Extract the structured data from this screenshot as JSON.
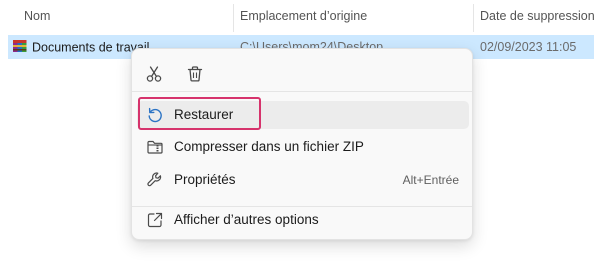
{
  "columns": {
    "name": "Nom",
    "origin": "Emplacement d’origine",
    "date": "Date de suppression"
  },
  "file": {
    "name": "Documents de travail",
    "origin": "C:\\Users\\mom24\\Desktop",
    "date": "02/09/2023 11:05",
    "icon": "winrar-archive-icon"
  },
  "context_menu": {
    "quick_actions": [
      {
        "name": "cut",
        "icon": "scissors-icon"
      },
      {
        "name": "delete",
        "icon": "trash-icon"
      }
    ],
    "items": [
      {
        "label": "Restaurer",
        "icon": "restore-icon",
        "shortcut": ""
      },
      {
        "label": "Compresser dans un fichier ZIP",
        "icon": "zip-folder-icon",
        "shortcut": ""
      },
      {
        "label": "Propriétés",
        "icon": "wrench-icon",
        "shortcut": "Alt+Entrée"
      }
    ],
    "more_options": {
      "label": "Afficher d’autres options",
      "icon": "open-external-icon"
    }
  },
  "colors": {
    "selection": "#cce8ff",
    "menu_background": "#f9f9f9",
    "hover_background": "#ececec",
    "highlight_border": "#d6336c"
  }
}
